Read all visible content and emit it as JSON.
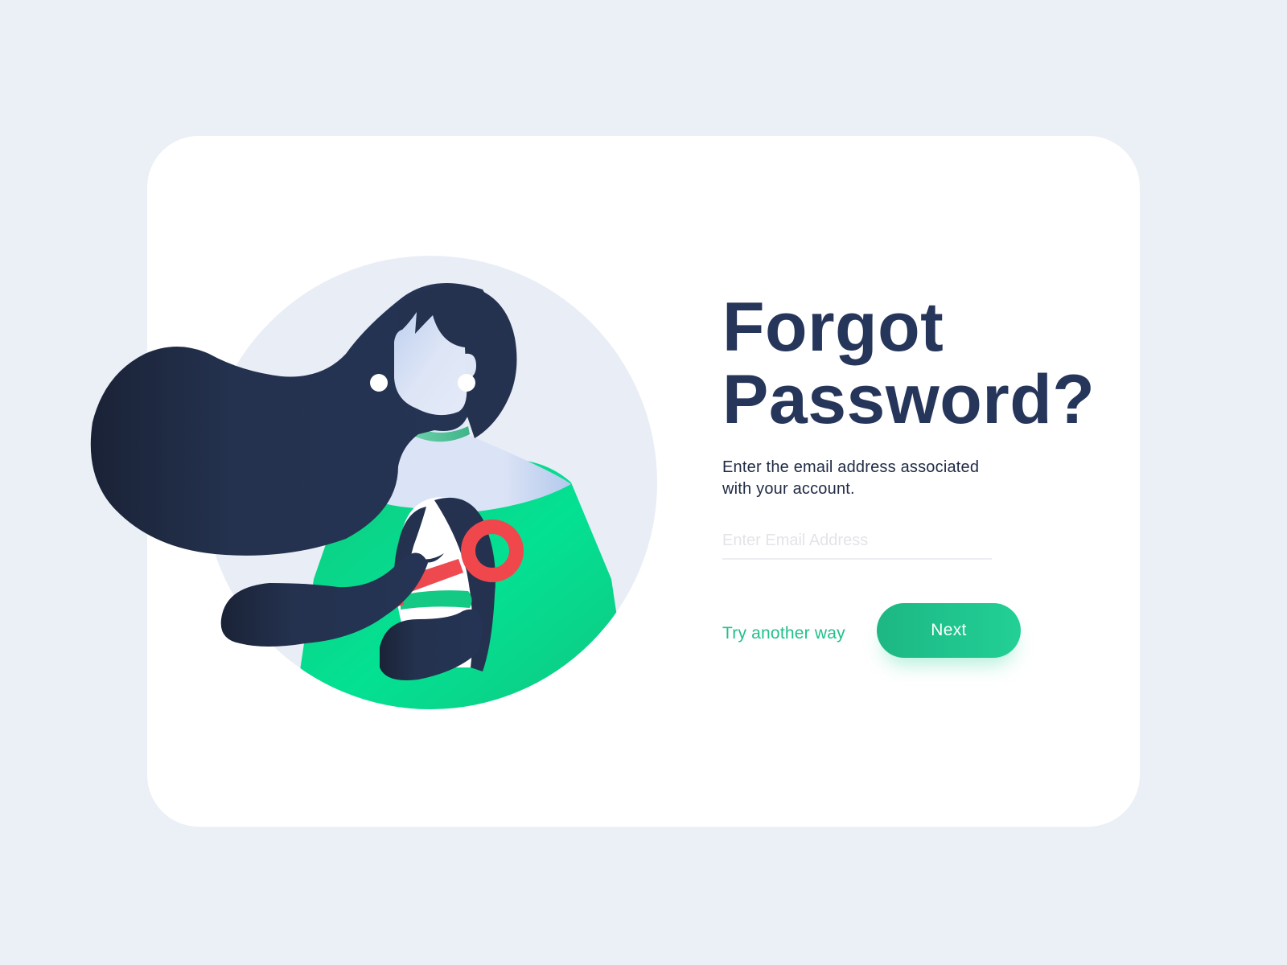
{
  "page": {
    "background_color": "#ebeff6",
    "card_color": "#ffffff"
  },
  "illustration": {
    "subject": "woman holding a dog with a key in its mouth",
    "icons": [
      "woman-illustration",
      "dog-illustration",
      "key-icon"
    ]
  },
  "form": {
    "title_line1": "Forgot",
    "title_line2": "Password?",
    "subtitle": "Enter the email address associated with your account.",
    "email_placeholder": "Enter Email Address",
    "email_value": "",
    "try_another_way_label": "Try another way",
    "next_label": "Next"
  },
  "colors": {
    "title": "#26355a",
    "accent": "#22c08a",
    "button_gradient_start": "#1db784",
    "button_gradient_end": "#22d096",
    "hair": "#24324f",
    "skin": "#dbe4f6",
    "shirt": "#0fd68a",
    "key": "#f0474c"
  }
}
